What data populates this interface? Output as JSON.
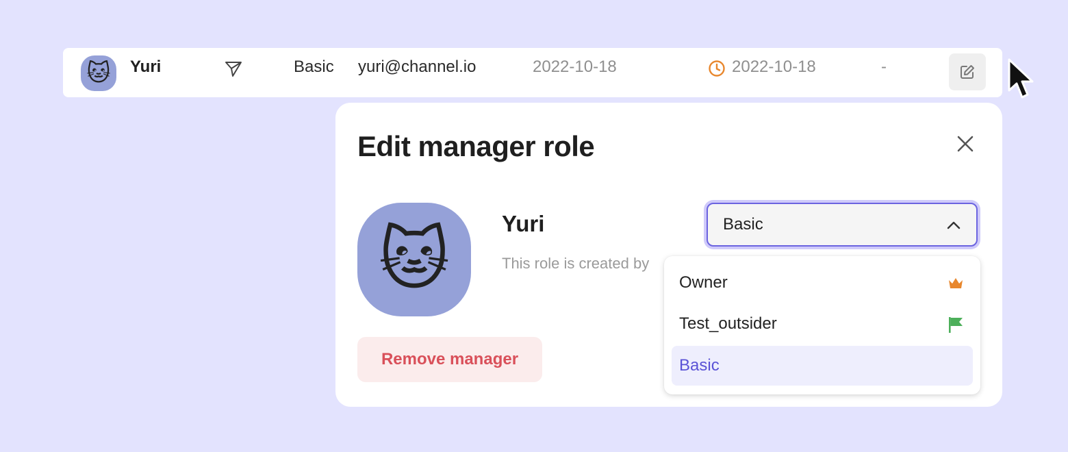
{
  "row": {
    "avatar_emoji": "🐱",
    "name": "Yuri",
    "send_icon": "send-icon",
    "role": "Basic",
    "email": "yuri@channel.io",
    "created_date": "2022-10-18",
    "clock_icon": "clock-icon",
    "last_active_date": "2022-10-18",
    "extra": "-",
    "edit_icon": "edit-icon"
  },
  "modal": {
    "title": "Edit manager role",
    "close_icon": "close-icon",
    "avatar_emoji": "🐱",
    "user_name": "Yuri",
    "role_description": "This role is created by",
    "remove_label": "Remove manager",
    "select": {
      "value": "Basic",
      "chevron_icon": "chevron-up-icon"
    },
    "options": [
      {
        "label": "Owner",
        "icon": "crown-icon",
        "color": "#e8872d"
      },
      {
        "label": "Test_outsider",
        "icon": "flag-icon",
        "color": "#4caf5a"
      },
      {
        "label": "Basic",
        "selected": true
      }
    ]
  },
  "colors": {
    "background": "#e3e3fe",
    "accent": "#6b63e0",
    "avatar_bg": "#95a1d8",
    "danger": "#d9505a",
    "clock": "#e8872d"
  }
}
